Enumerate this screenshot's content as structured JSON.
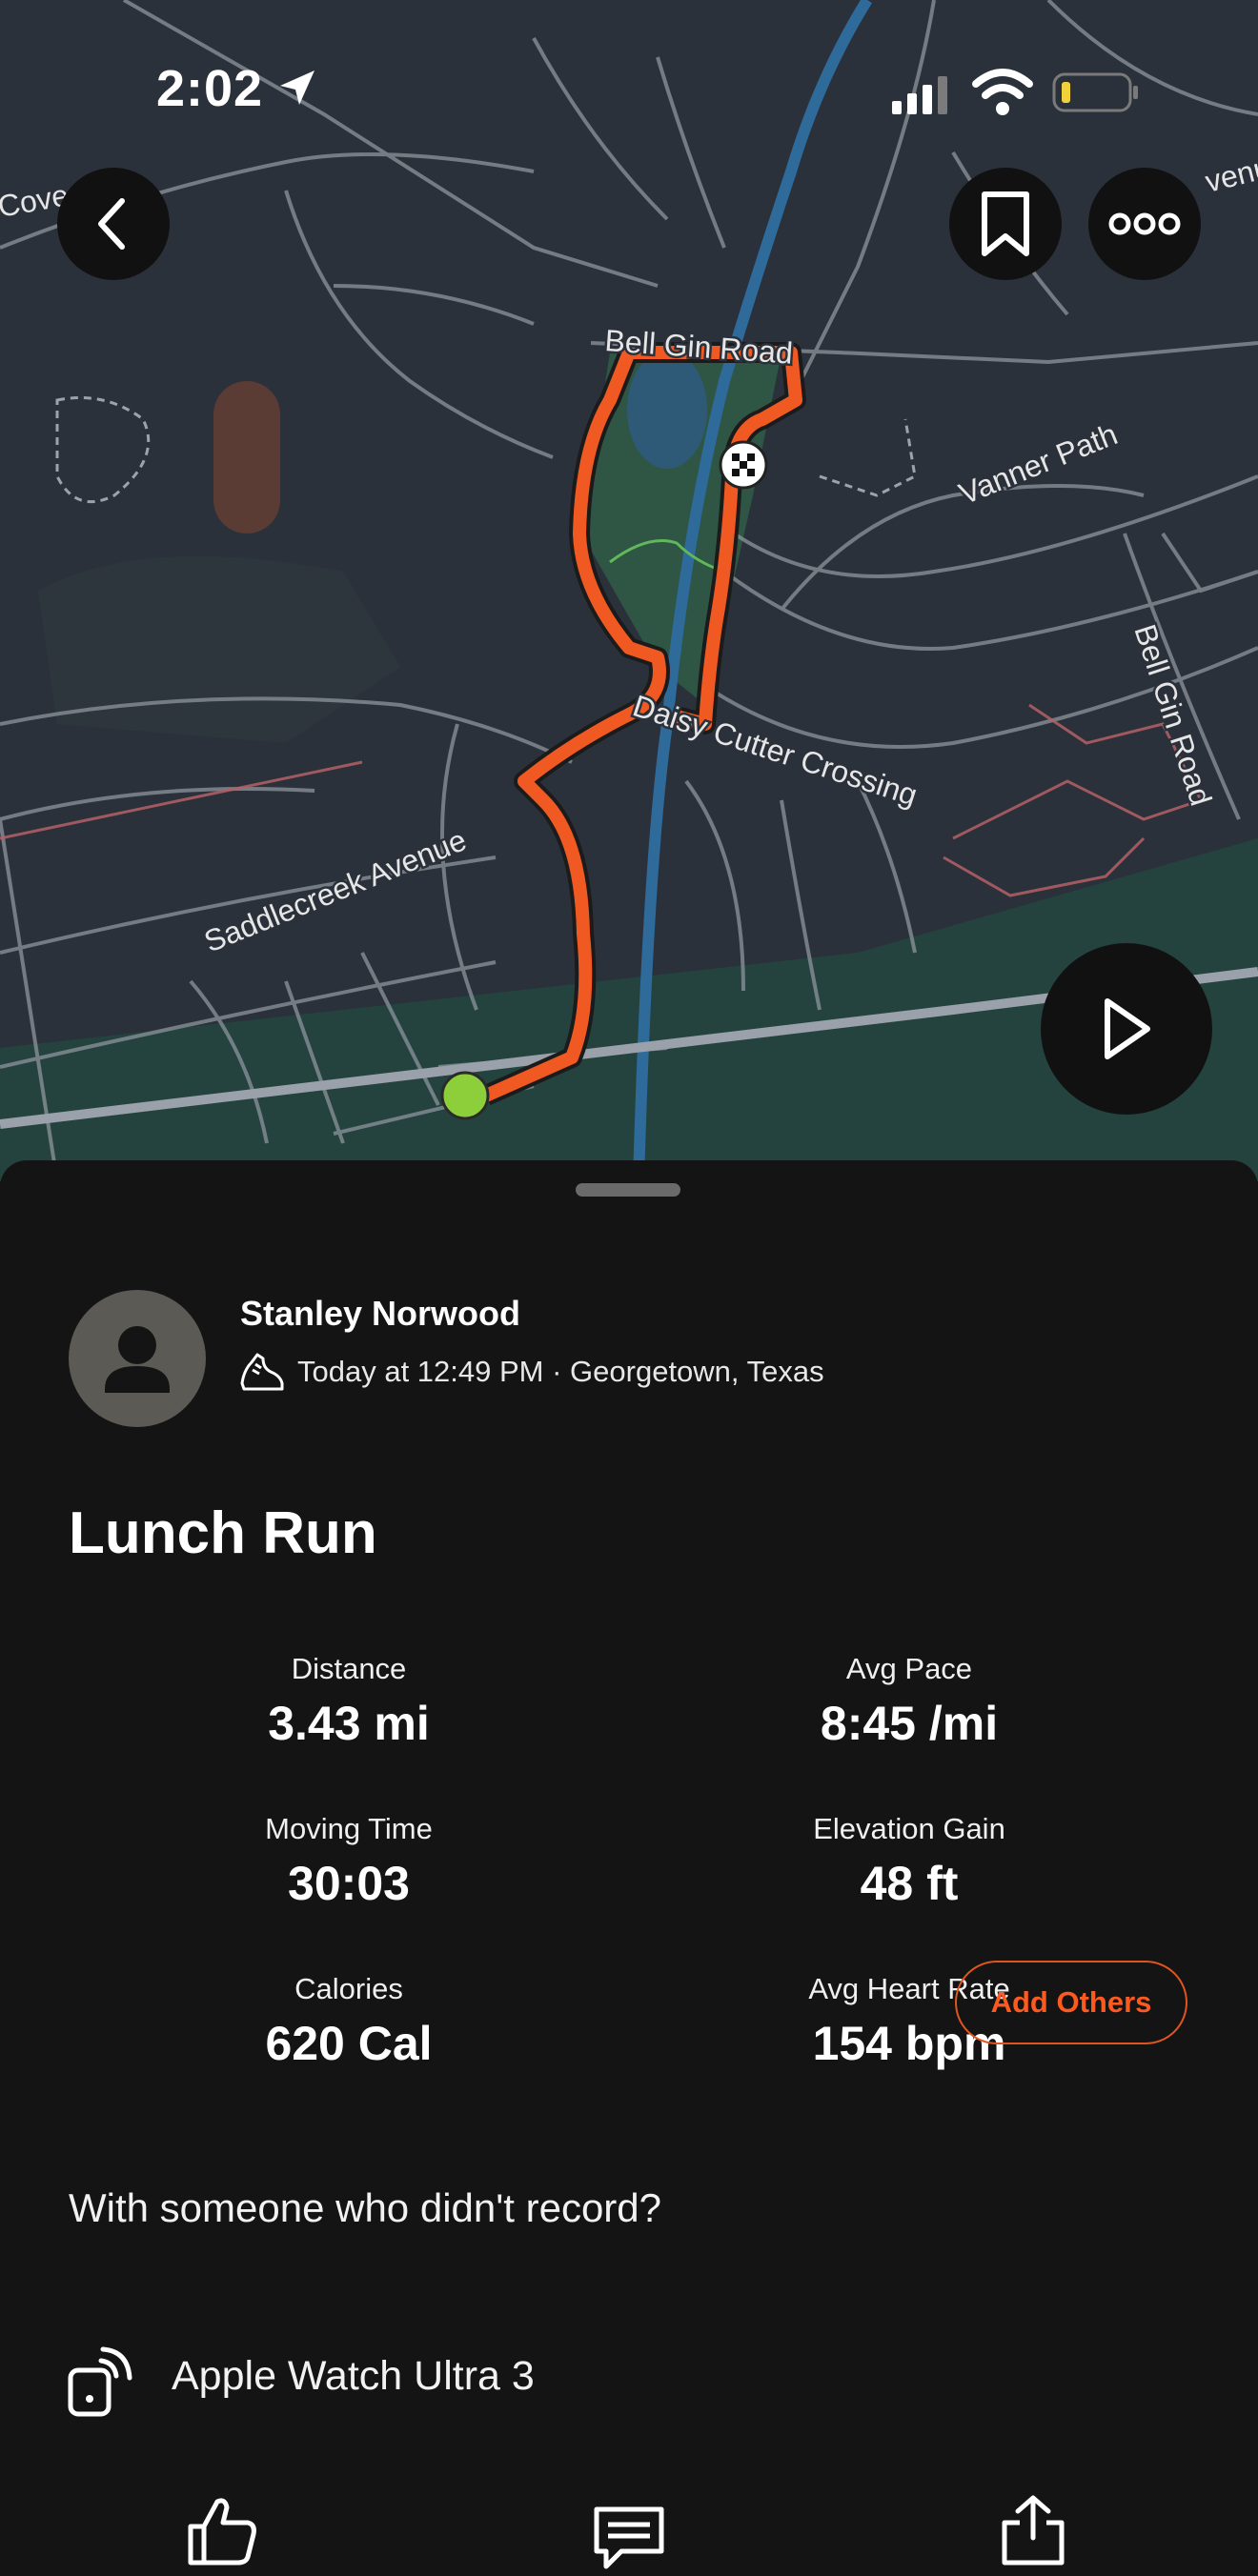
{
  "status_bar": {
    "time": "2:02"
  },
  "map": {
    "street_labels": [
      "Bell Gin Road",
      "Vanner Path",
      "Bell Gin Road",
      "Daisy Cutter Crossing",
      "Saddlecreek Avenue",
      "Cove",
      "venu"
    ],
    "route_color": "#f05a22",
    "start_marker_color": "#8ccf3a",
    "background_color": "#2a303a"
  },
  "activity": {
    "athlete_name": "Stanley Norwood",
    "meta": "Today at 12:49 PM · Georgetown, Texas",
    "title": "Lunch Run",
    "stats": [
      {
        "label": "Distance",
        "value": "3.43 mi"
      },
      {
        "label": "Avg Pace",
        "value": "8:45 /mi"
      },
      {
        "label": "Moving Time",
        "value": "30:03"
      },
      {
        "label": "Elevation Gain",
        "value": "48 ft"
      },
      {
        "label": "Calories",
        "value": "620 Cal"
      },
      {
        "label": "Avg Heart Rate",
        "value": "154 bpm"
      }
    ],
    "with_others_prompt": "With someone who didn't record?",
    "add_others_label": "Add Others",
    "device_name": "Apple Watch Ultra 3"
  },
  "icons": {
    "back": "chevron-left-icon",
    "bookmark": "bookmark-icon",
    "more": "more-icon",
    "play": "play-icon",
    "kudos": "thumbs-up-icon",
    "comment": "comment-icon",
    "share": "share-icon"
  },
  "colors": {
    "accent": "#fc5a1f",
    "background": "#141414"
  }
}
